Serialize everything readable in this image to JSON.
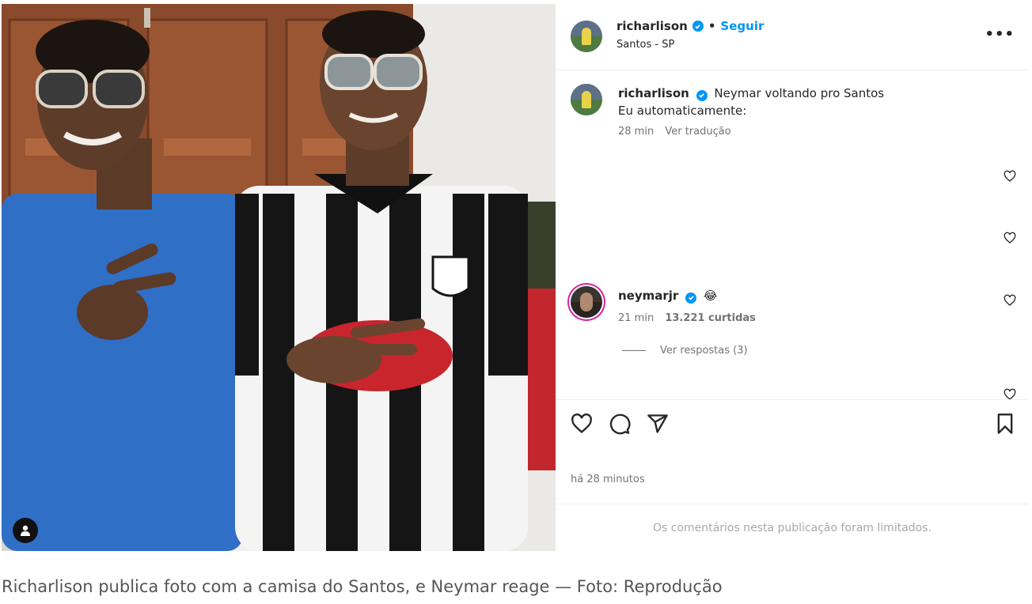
{
  "post": {
    "username": "richarlison",
    "follow_label": "Seguir",
    "separator": "•",
    "location": "Santos - SP",
    "more_label": "•••"
  },
  "caption": {
    "username": "richarlison",
    "line1": "Neymar voltando pro Santos",
    "line2": "Eu automaticamente:",
    "time": "28 min",
    "translate_label": "Ver tradução"
  },
  "comment": {
    "username": "neymarjr",
    "text": "😂",
    "time": "21 min",
    "likes": "13.221 curtidas",
    "view_replies": "Ver respostas (3)"
  },
  "footer": {
    "time_ago": "há 28 minutos",
    "limited_notice": "Os comentários nesta publicação foram limitados."
  },
  "figure_caption": "Richarlison publica foto com a camisa do Santos, e Neymar reage — Foto: Reprodução",
  "icons": {
    "verified": "verified-badge-icon",
    "like": "heart-icon",
    "comment": "comment-icon",
    "share": "share-icon",
    "save": "bookmark-icon",
    "user_tag": "user-tag-icon"
  },
  "colors": {
    "link_blue": "#0095f6",
    "muted_text": "#737373",
    "story_ring": "#d6249f"
  }
}
